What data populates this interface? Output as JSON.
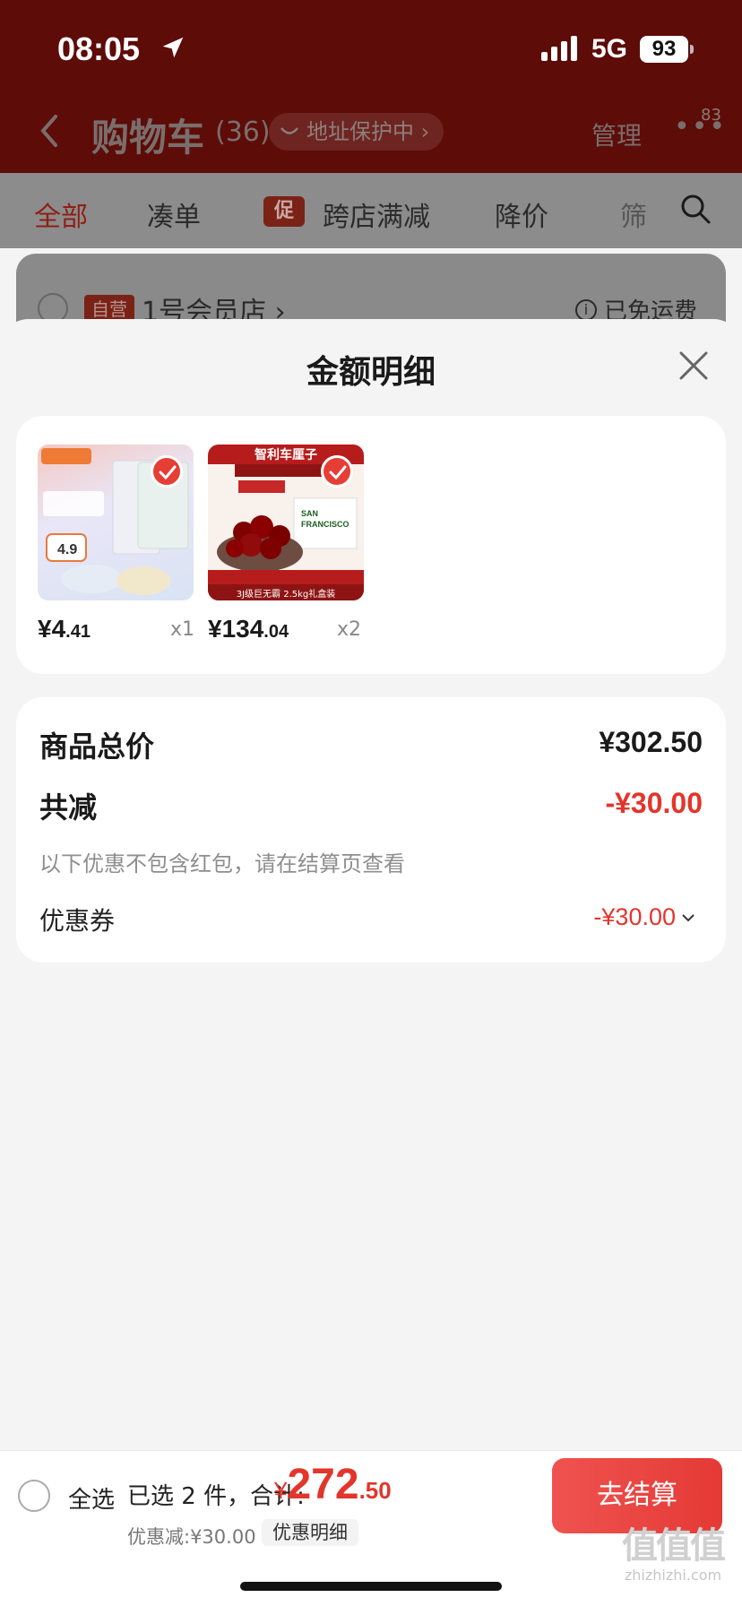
{
  "status_bar": {
    "time": "08:05",
    "network": "5G",
    "battery": "93"
  },
  "header": {
    "title": "购物车",
    "count": "(36)",
    "address_pill": "地址保护中 ›",
    "manage_label": "管理",
    "more_label": "•••",
    "badge": "83"
  },
  "tabs": [
    {
      "label": "全部"
    },
    {
      "label": "凑单"
    },
    {
      "label": "跨店满减",
      "tag": "促"
    },
    {
      "label": "降价"
    },
    {
      "label": "筛"
    }
  ],
  "store": {
    "tag": "自营",
    "name": "1号会员店 ›",
    "shipping": "已免运费"
  },
  "sheet": {
    "title": "金额明细",
    "items": [
      {
        "price_int": "¥4",
        "price_dec": ".41",
        "qty": "x1"
      },
      {
        "price_int": "¥134",
        "price_dec": ".04",
        "qty": "x2",
        "banner": "智利车厘子",
        "sub": "3J级巨无霸 2.5kg礼盒装"
      }
    ],
    "summary": {
      "subtotal_label": "商品总价",
      "subtotal_value": "¥302.50",
      "discount_label": "共减",
      "discount_value": "-¥30.00",
      "discount_note": "以下优惠不包含红包，请在结算页查看",
      "coupon_label": "优惠券",
      "coupon_value": "-¥30.00"
    }
  },
  "bottom_bar": {
    "select_all": "全选",
    "selected": "已选 2 件，合计:",
    "total_cur": "¥",
    "total_int": "272",
    "total_dec": ".50",
    "discount": "优惠减:¥30.00",
    "detail": "优惠明细",
    "checkout": "去结算"
  },
  "watermark": {
    "big": "值值值",
    "small": "zhizhizhi.com"
  },
  "colors": {
    "header_bg": "#5d0c08",
    "accent_red": "#e2362c"
  }
}
